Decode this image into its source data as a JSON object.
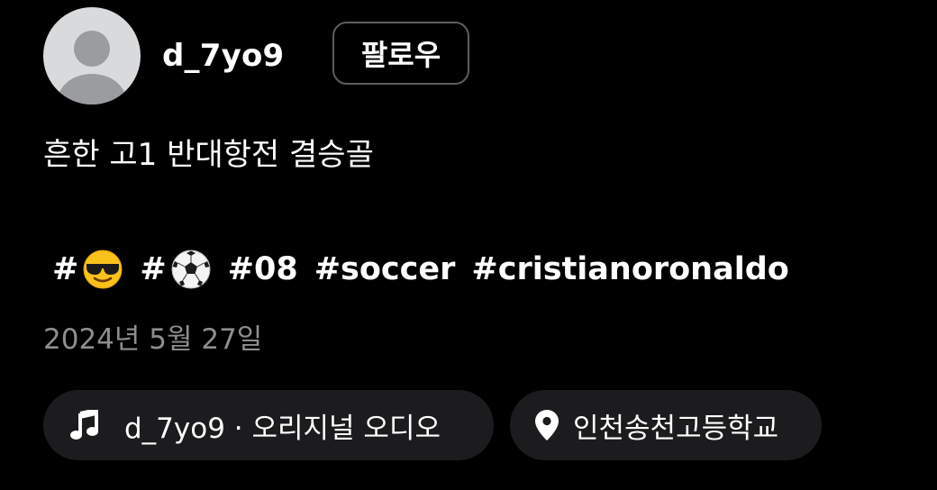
{
  "post": {
    "username": "d_7yo9",
    "follow_label": "팔로우",
    "caption": "흔한 고1 반대항전 결승골",
    "hashtags": [
      {
        "text": "#",
        "emoji": "smiling-face-with-sunglasses-icon"
      },
      {
        "text": "#",
        "emoji": "soccer-ball-icon"
      },
      {
        "text": "#08"
      },
      {
        "text": "#soccer"
      },
      {
        "text": "#cristianoronaldo"
      }
    ],
    "date": "2024년 5월 27일",
    "audio_label": "d_7yo9 · 오리지널 오디오",
    "location_label": "인천송천고등학교"
  },
  "icons": {
    "avatar": "default-avatar-icon",
    "audio": "music-note-icon",
    "location": "location-pin-icon"
  },
  "colors": {
    "background": "#000000",
    "text": "#ffffff",
    "secondary_text": "#8e8e8e",
    "pill_background": "#1c1c1e",
    "button_border": "#5e5e5e",
    "avatar_background": "#d9dadc",
    "avatar_silhouette": "#9a9ca0"
  }
}
